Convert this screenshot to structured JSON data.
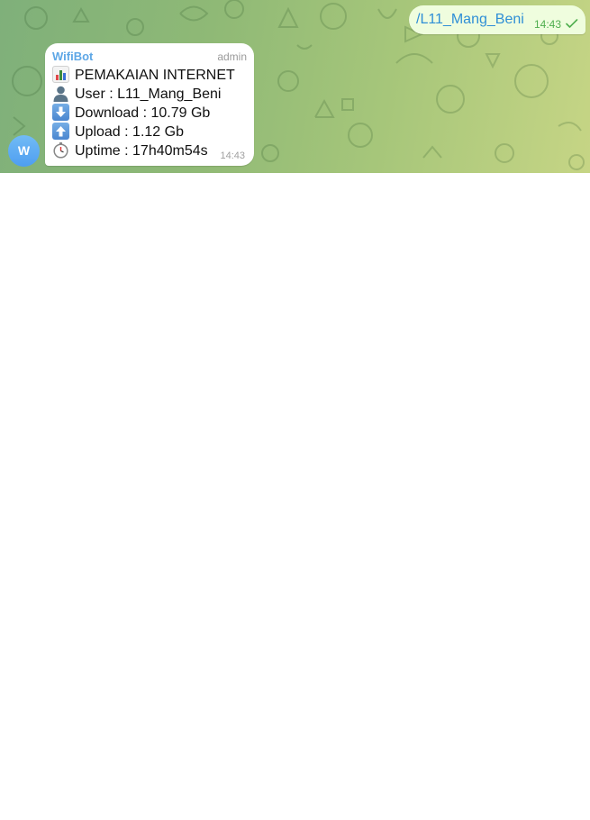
{
  "outgoing": {
    "text": "/L11_Mang_Beni",
    "time": "14:43",
    "status_icon": "double-check-icon"
  },
  "incoming": {
    "avatar_letter": "W",
    "sender": "WifiBot",
    "role": "admin",
    "time": "14:43",
    "lines": [
      {
        "icon": "bar-chart-icon",
        "text": "PEMAKAIAN INTERNET"
      },
      {
        "icon": "user-silhouette-icon",
        "text": "User : L11_Mang_Beni"
      },
      {
        "icon": "down-arrow-icon",
        "text": "Download : 10.79 Gb"
      },
      {
        "icon": "up-arrow-icon",
        "text": "Upload : 1.12 Gb"
      },
      {
        "icon": "stopwatch-icon",
        "text": "Uptime : 17h40m54s"
      }
    ]
  },
  "colors": {
    "wallpaper_start": "#7fb07a",
    "wallpaper_end": "#c6d585",
    "outgoing_bubble": "#effdde",
    "link_text": "#2f8fd6",
    "sender_name": "#5ea7e6",
    "avatar": "#5aa8f2"
  }
}
